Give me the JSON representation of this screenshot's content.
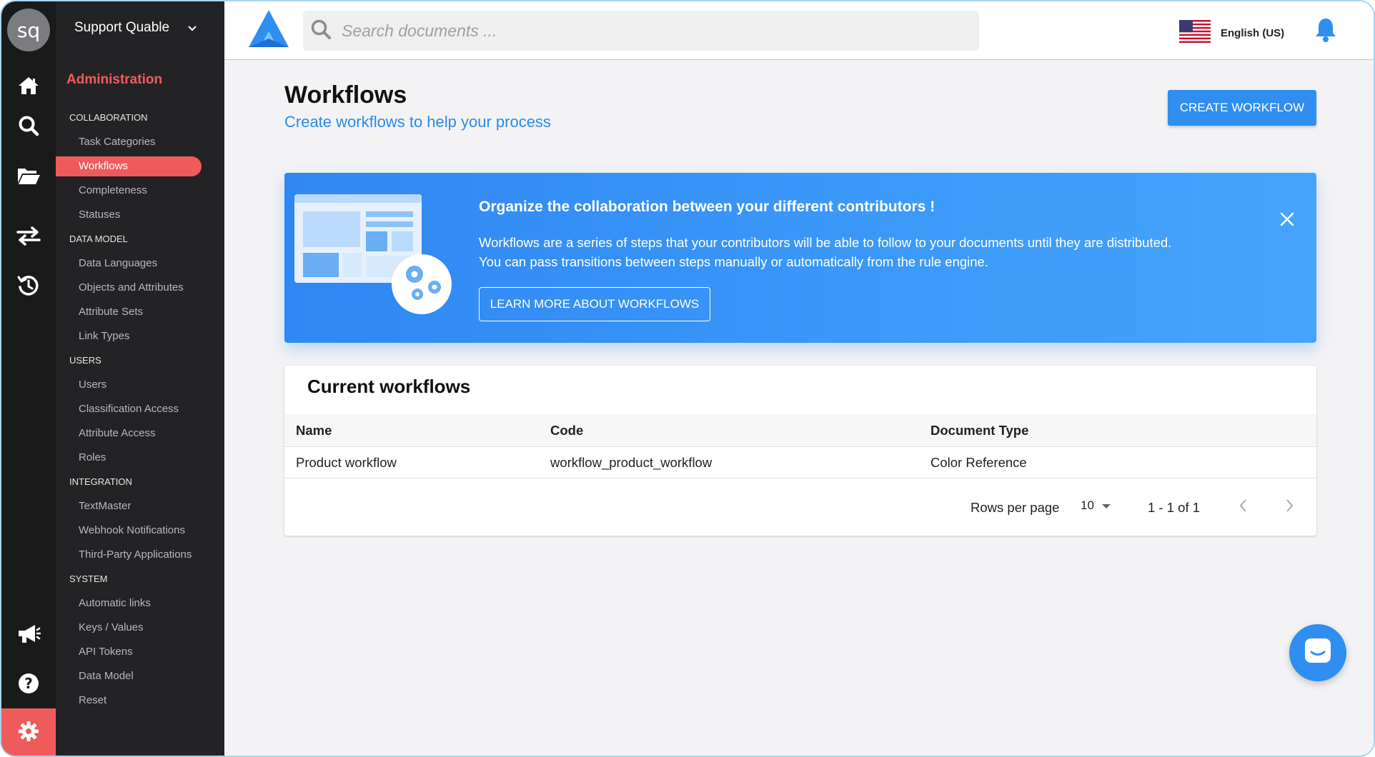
{
  "rail": {
    "avatar_initials": "sq",
    "icons": [
      "home-icon",
      "search-icon",
      "folder-open-icon",
      "transfer-arrows-icon",
      "history-icon",
      "megaphone-icon",
      "help-icon",
      "gear-icon"
    ]
  },
  "sidebar": {
    "workspace": "Support Quable",
    "title": "Administration",
    "sections": [
      {
        "label": "COLLABORATION",
        "items": [
          "Task Categories",
          "Workflows",
          "Completeness",
          "Statuses"
        ]
      },
      {
        "label": "DATA MODEL",
        "items": [
          "Data Languages",
          "Objects and Attributes",
          "Attribute Sets",
          "Link Types"
        ]
      },
      {
        "label": "USERS",
        "items": [
          "Users",
          "Classification Access",
          "Attribute Access",
          "Roles"
        ]
      },
      {
        "label": "INTEGRATION",
        "items": [
          "TextMaster",
          "Webhook Notifications",
          "Third-Party Applications"
        ]
      },
      {
        "label": "SYSTEM",
        "items": [
          "Automatic links",
          "Keys / Values",
          "API Tokens",
          "Data Model",
          "Reset"
        ]
      }
    ],
    "active_item": "Workflows"
  },
  "topbar": {
    "search_placeholder": "Search documents ...",
    "language": "English (US)"
  },
  "main": {
    "title": "Workflows",
    "subtitle": "Create workflows to help your process",
    "create_button": "CREATE WORKFLOW",
    "banner": {
      "heading": "Organize the collaboration between your different contributors !",
      "line1": "Workflows are a series of steps that your contributors will be able to follow to your documents until they are distributed.",
      "line2": "You can pass transitions between steps manually or automatically from the rule engine.",
      "button": "LEARN MORE ABOUT WORKFLOWS"
    },
    "table": {
      "title": "Current workflows",
      "columns": [
        "Name",
        "Code",
        "Document Type"
      ],
      "rows": [
        [
          "Product workflow",
          "workflow_product_workflow",
          "Color Reference"
        ]
      ],
      "rows_per_page_label": "Rows per page",
      "rows_per_page": "10",
      "range": "1 - 1 of 1"
    }
  },
  "colors": {
    "accent_red": "#ef5b5b",
    "primary_blue": "#2f8ef0",
    "sidebar_bg": "#232325",
    "rail_bg": "#1a1a1b"
  }
}
